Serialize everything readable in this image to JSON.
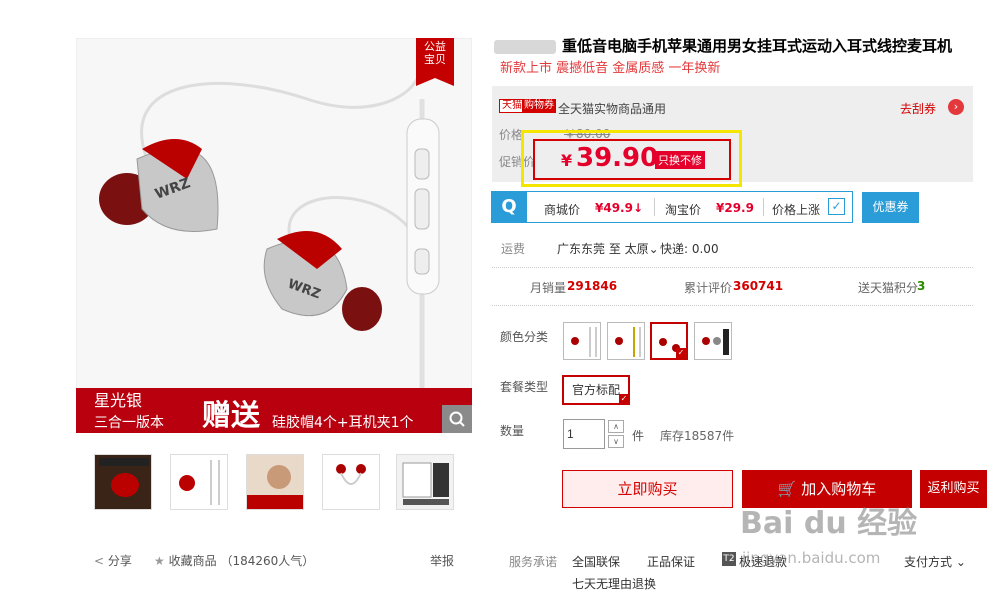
{
  "gallery": {
    "public_welfare_badge": "公益\n宝贝",
    "color_name": "星光银",
    "edition": "三合一版本",
    "gift_word": "赠送",
    "gift_detail": "硅胶帽4个+耳机夹1个",
    "zoom_icon": "search-icon",
    "brand_mark": "WRZ"
  },
  "actions": {
    "share": "分享",
    "favorite": "收藏商品",
    "popularity": "（184260人气）",
    "report": "举报"
  },
  "product": {
    "title": "重低音电脑手机苹果通用男女挂耳式运动入耳式线控麦耳机",
    "subtitle": "新款上市 震撼低音 金属质感 一年换新"
  },
  "price_panel": {
    "tmall_tag": "天猫",
    "coupon_tag": "购物券",
    "coupon_desc": "全天猫实物商品通用",
    "get_coupon": "去刮券",
    "price_label": "价格",
    "original_price": "￥80.00",
    "promo_label": "促销价",
    "currency": "¥",
    "promo_price": "39.90",
    "promo_note": "只换不修"
  },
  "comparison": {
    "mall_price_label": "商城价",
    "mall_price": "¥49.9↓",
    "taobao_price_label": "淘宝价",
    "taobao_price": "¥29.9",
    "price_rise_label": "价格上涨",
    "coupon_button": "优惠券"
  },
  "shipping": {
    "label": "运费",
    "route": "广东东莞 至 太原",
    "express": "快递: 0.00"
  },
  "stats": {
    "monthly_sales_label": "月销量",
    "monthly_sales": "291846",
    "reviews_label": "累计评价",
    "reviews": "360741",
    "points_label": "送天猫积分",
    "points": "3"
  },
  "sku": {
    "color_label": "颜色分类",
    "package_label": "套餐类型",
    "package_option": "官方标配",
    "quantity_label": "数量",
    "quantity": "1",
    "unit": "件",
    "stock": "库存18587件"
  },
  "buttons": {
    "buy_now": "立即购买",
    "add_to_cart": "加入购物车",
    "rebate_buy": "返利购买"
  },
  "services": {
    "label": "服务承诺",
    "items": [
      "全国联保",
      "正品保证",
      "极速退款",
      "七天无理由退换"
    ],
    "payment": "支付方式",
    "fast_tag": "T2"
  },
  "watermark": {
    "text": "Bai du 经验",
    "url": "jingyan.baidu.com"
  },
  "colors": {
    "tmall_red": "#c40000",
    "price_red": "#e4002b",
    "compare_blue": "#2a9cd8",
    "highlight_yellow": "#f5e600"
  }
}
